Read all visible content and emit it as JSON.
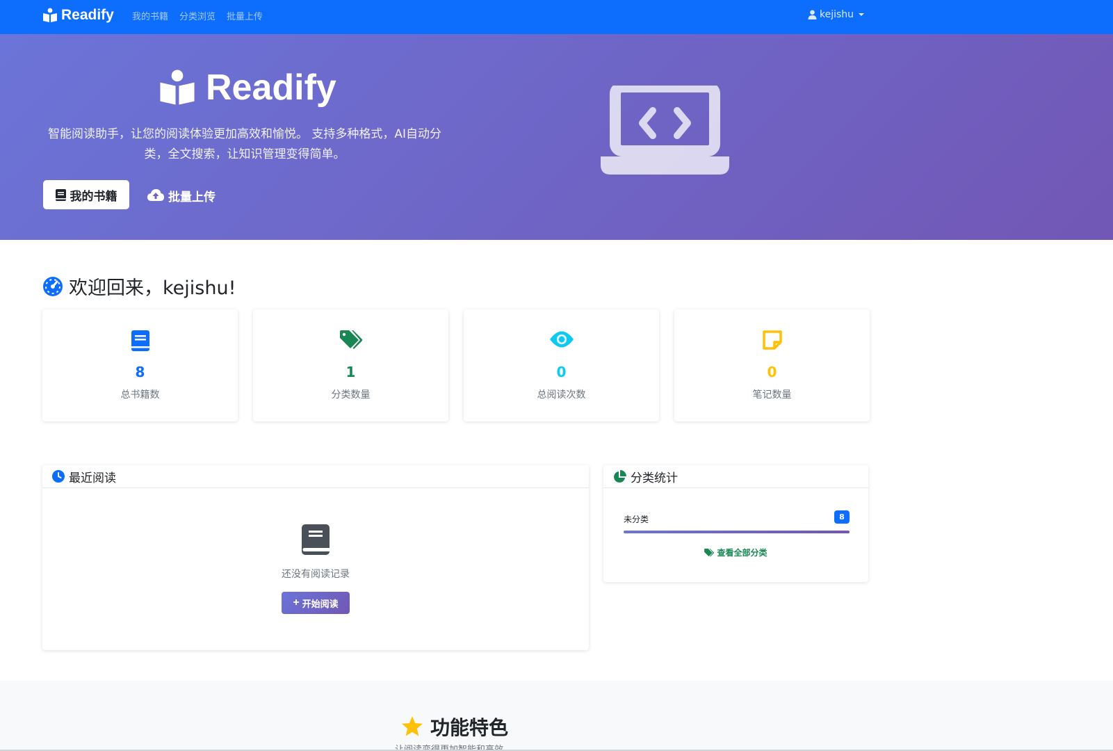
{
  "navbar": {
    "brand": "Readify",
    "links": [
      "我的书籍",
      "分类浏览",
      "批量上传"
    ],
    "user": "kejishu",
    "color": "#0d6efd"
  },
  "hero": {
    "title": "Readify",
    "description": "智能阅读助手，让您的阅读体验更加高效和愉悦。 支持多种格式，AI自动分类，全文搜索，让知识管理变得简单。",
    "btn_books": "我的书籍",
    "btn_upload": "批量上传",
    "illustration": "laptop-code-icon"
  },
  "welcome": {
    "text": "欢迎回来，kejishu!"
  },
  "stats": [
    {
      "icon": "book-icon",
      "value": "8",
      "label": "总书籍数",
      "color": "#0d6efd"
    },
    {
      "icon": "tags-icon",
      "value": "1",
      "label": "分类数量",
      "color": "#198754"
    },
    {
      "icon": "eye-icon",
      "value": "0",
      "label": "总阅读次数",
      "color": "#0dcaf0"
    },
    {
      "icon": "sticky-note-icon",
      "value": "0",
      "label": "笔记数量",
      "color": "#ffc107"
    }
  ],
  "recent": {
    "title": "最近阅读",
    "empty_text": "还没有阅读记录",
    "start_btn": "开始阅读"
  },
  "categories": {
    "title": "分类统计",
    "items": [
      {
        "name": "未分类",
        "count": "8",
        "fraction": 1.0
      }
    ],
    "view_all": "查看全部分类"
  },
  "features": {
    "title": "功能特色",
    "subtitle": "让阅读变得更加智能和高效"
  }
}
